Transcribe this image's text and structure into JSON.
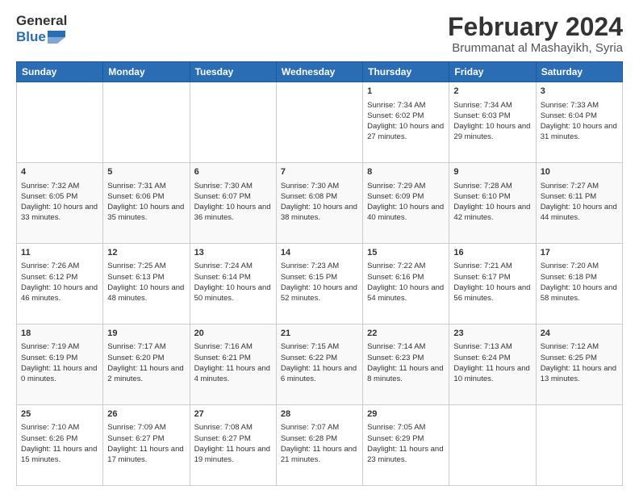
{
  "header": {
    "logo_general": "General",
    "logo_blue": "Blue",
    "month_title": "February 2024",
    "location": "Brummanat al Mashayikh, Syria"
  },
  "days_of_week": [
    "Sunday",
    "Monday",
    "Tuesday",
    "Wednesday",
    "Thursday",
    "Friday",
    "Saturday"
  ],
  "weeks": [
    [
      {
        "day": "",
        "sunrise": "",
        "sunset": "",
        "daylight": ""
      },
      {
        "day": "",
        "sunrise": "",
        "sunset": "",
        "daylight": ""
      },
      {
        "day": "",
        "sunrise": "",
        "sunset": "",
        "daylight": ""
      },
      {
        "day": "",
        "sunrise": "",
        "sunset": "",
        "daylight": ""
      },
      {
        "day": "1",
        "sunrise": "Sunrise: 7:34 AM",
        "sunset": "Sunset: 6:02 PM",
        "daylight": "Daylight: 10 hours and 27 minutes."
      },
      {
        "day": "2",
        "sunrise": "Sunrise: 7:34 AM",
        "sunset": "Sunset: 6:03 PM",
        "daylight": "Daylight: 10 hours and 29 minutes."
      },
      {
        "day": "3",
        "sunrise": "Sunrise: 7:33 AM",
        "sunset": "Sunset: 6:04 PM",
        "daylight": "Daylight: 10 hours and 31 minutes."
      }
    ],
    [
      {
        "day": "4",
        "sunrise": "Sunrise: 7:32 AM",
        "sunset": "Sunset: 6:05 PM",
        "daylight": "Daylight: 10 hours and 33 minutes."
      },
      {
        "day": "5",
        "sunrise": "Sunrise: 7:31 AM",
        "sunset": "Sunset: 6:06 PM",
        "daylight": "Daylight: 10 hours and 35 minutes."
      },
      {
        "day": "6",
        "sunrise": "Sunrise: 7:30 AM",
        "sunset": "Sunset: 6:07 PM",
        "daylight": "Daylight: 10 hours and 36 minutes."
      },
      {
        "day": "7",
        "sunrise": "Sunrise: 7:30 AM",
        "sunset": "Sunset: 6:08 PM",
        "daylight": "Daylight: 10 hours and 38 minutes."
      },
      {
        "day": "8",
        "sunrise": "Sunrise: 7:29 AM",
        "sunset": "Sunset: 6:09 PM",
        "daylight": "Daylight: 10 hours and 40 minutes."
      },
      {
        "day": "9",
        "sunrise": "Sunrise: 7:28 AM",
        "sunset": "Sunset: 6:10 PM",
        "daylight": "Daylight: 10 hours and 42 minutes."
      },
      {
        "day": "10",
        "sunrise": "Sunrise: 7:27 AM",
        "sunset": "Sunset: 6:11 PM",
        "daylight": "Daylight: 10 hours and 44 minutes."
      }
    ],
    [
      {
        "day": "11",
        "sunrise": "Sunrise: 7:26 AM",
        "sunset": "Sunset: 6:12 PM",
        "daylight": "Daylight: 10 hours and 46 minutes."
      },
      {
        "day": "12",
        "sunrise": "Sunrise: 7:25 AM",
        "sunset": "Sunset: 6:13 PM",
        "daylight": "Daylight: 10 hours and 48 minutes."
      },
      {
        "day": "13",
        "sunrise": "Sunrise: 7:24 AM",
        "sunset": "Sunset: 6:14 PM",
        "daylight": "Daylight: 10 hours and 50 minutes."
      },
      {
        "day": "14",
        "sunrise": "Sunrise: 7:23 AM",
        "sunset": "Sunset: 6:15 PM",
        "daylight": "Daylight: 10 hours and 52 minutes."
      },
      {
        "day": "15",
        "sunrise": "Sunrise: 7:22 AM",
        "sunset": "Sunset: 6:16 PM",
        "daylight": "Daylight: 10 hours and 54 minutes."
      },
      {
        "day": "16",
        "sunrise": "Sunrise: 7:21 AM",
        "sunset": "Sunset: 6:17 PM",
        "daylight": "Daylight: 10 hours and 56 minutes."
      },
      {
        "day": "17",
        "sunrise": "Sunrise: 7:20 AM",
        "sunset": "Sunset: 6:18 PM",
        "daylight": "Daylight: 10 hours and 58 minutes."
      }
    ],
    [
      {
        "day": "18",
        "sunrise": "Sunrise: 7:19 AM",
        "sunset": "Sunset: 6:19 PM",
        "daylight": "Daylight: 11 hours and 0 minutes."
      },
      {
        "day": "19",
        "sunrise": "Sunrise: 7:17 AM",
        "sunset": "Sunset: 6:20 PM",
        "daylight": "Daylight: 11 hours and 2 minutes."
      },
      {
        "day": "20",
        "sunrise": "Sunrise: 7:16 AM",
        "sunset": "Sunset: 6:21 PM",
        "daylight": "Daylight: 11 hours and 4 minutes."
      },
      {
        "day": "21",
        "sunrise": "Sunrise: 7:15 AM",
        "sunset": "Sunset: 6:22 PM",
        "daylight": "Daylight: 11 hours and 6 minutes."
      },
      {
        "day": "22",
        "sunrise": "Sunrise: 7:14 AM",
        "sunset": "Sunset: 6:23 PM",
        "daylight": "Daylight: 11 hours and 8 minutes."
      },
      {
        "day": "23",
        "sunrise": "Sunrise: 7:13 AM",
        "sunset": "Sunset: 6:24 PM",
        "daylight": "Daylight: 11 hours and 10 minutes."
      },
      {
        "day": "24",
        "sunrise": "Sunrise: 7:12 AM",
        "sunset": "Sunset: 6:25 PM",
        "daylight": "Daylight: 11 hours and 13 minutes."
      }
    ],
    [
      {
        "day": "25",
        "sunrise": "Sunrise: 7:10 AM",
        "sunset": "Sunset: 6:26 PM",
        "daylight": "Daylight: 11 hours and 15 minutes."
      },
      {
        "day": "26",
        "sunrise": "Sunrise: 7:09 AM",
        "sunset": "Sunset: 6:27 PM",
        "daylight": "Daylight: 11 hours and 17 minutes."
      },
      {
        "day": "27",
        "sunrise": "Sunrise: 7:08 AM",
        "sunset": "Sunset: 6:27 PM",
        "daylight": "Daylight: 11 hours and 19 minutes."
      },
      {
        "day": "28",
        "sunrise": "Sunrise: 7:07 AM",
        "sunset": "Sunset: 6:28 PM",
        "daylight": "Daylight: 11 hours and 21 minutes."
      },
      {
        "day": "29",
        "sunrise": "Sunrise: 7:05 AM",
        "sunset": "Sunset: 6:29 PM",
        "daylight": "Daylight: 11 hours and 23 minutes."
      },
      {
        "day": "",
        "sunrise": "",
        "sunset": "",
        "daylight": ""
      },
      {
        "day": "",
        "sunrise": "",
        "sunset": "",
        "daylight": ""
      }
    ]
  ]
}
